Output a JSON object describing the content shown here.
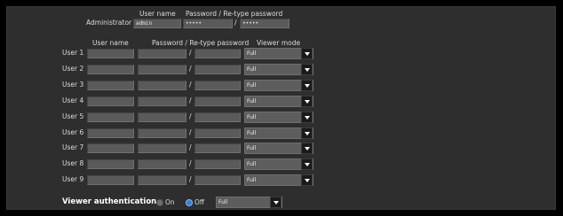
{
  "admin": {
    "label": "Administrator",
    "col_username": "User name",
    "col_password": "Password / Re-type password",
    "username": "admin",
    "password": "•••••",
    "retype": "•••••"
  },
  "users_header": {
    "username": "User name",
    "password": "Password / Re-type password",
    "viewer_mode": "Viewer mode"
  },
  "users": [
    {
      "label": "User 1",
      "username": "",
      "password": "",
      "retype": "",
      "mode": "Full"
    },
    {
      "label": "User 2",
      "username": "",
      "password": "",
      "retype": "",
      "mode": "Full"
    },
    {
      "label": "User 3",
      "username": "",
      "password": "",
      "retype": "",
      "mode": "Full"
    },
    {
      "label": "User 4",
      "username": "",
      "password": "",
      "retype": "",
      "mode": "Full"
    },
    {
      "label": "User 5",
      "username": "",
      "password": "",
      "retype": "",
      "mode": "Full"
    },
    {
      "label": "User 6",
      "username": "",
      "password": "",
      "retype": "",
      "mode": "Full"
    },
    {
      "label": "User 7",
      "username": "",
      "password": "",
      "retype": "",
      "mode": "Full"
    },
    {
      "label": "User 8",
      "username": "",
      "password": "",
      "retype": "",
      "mode": "Full"
    },
    {
      "label": "User 9",
      "username": "",
      "password": "",
      "retype": "",
      "mode": "Full"
    }
  ],
  "separator": "/",
  "viewer_auth": {
    "title": "Viewer authentication",
    "on_label": "On",
    "off_label": "Off",
    "selected": "Off",
    "mode": "Full"
  },
  "colors": {
    "background": "#000000",
    "panel": "#2e2e2e",
    "field": "#5a5a5a",
    "radio_selected": "#3a7bd5"
  }
}
